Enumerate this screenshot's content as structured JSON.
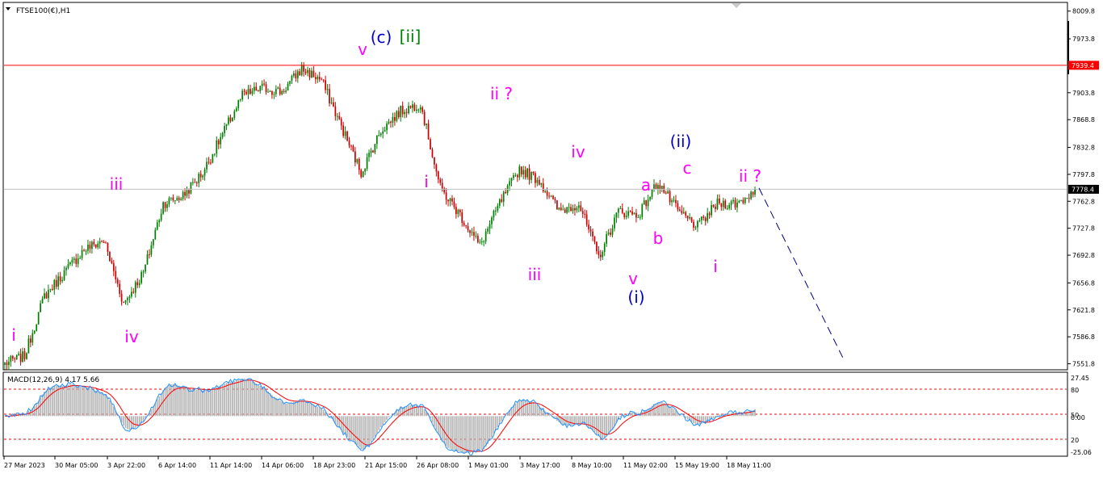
{
  "window": {
    "symbol_label": "FTSE100(€),H1"
  },
  "price_axis": {
    "ticks": [
      "8009.8",
      "7973.8",
      "7939.4",
      "7903.8",
      "7868.8",
      "7832.8",
      "7797.8",
      "7762.8",
      "7727.8",
      "7692.8",
      "7656.8",
      "7621.8",
      "7586.8",
      "7551.8"
    ],
    "hline_red_label": "7939.4",
    "current_price_label": "7778.4"
  },
  "macd": {
    "label": "MACD(12,26,9) 4.17 5.66",
    "ticks": [
      "27.45",
      "80",
      "50",
      "0.00",
      "20",
      "-25.06"
    ]
  },
  "time_axis": {
    "labels": [
      "27 Mar 2023",
      "30 Mar 05:00",
      "3 Apr 22:00",
      "6 Apr 14:00",
      "11 Apr 14:00",
      "14 Apr 06:00",
      "18 Apr 23:00",
      "21 Apr 15:00",
      "26 Apr 08:00",
      "1 May 01:00",
      "3 May 17:00",
      "8 May 10:00",
      "11 May 02:00",
      "15 May 19:00",
      "18 May 11:00"
    ]
  },
  "annotations": [
    {
      "text": "i",
      "color": "#ff00ff"
    },
    {
      "text": "iii",
      "color": "#ff00ff"
    },
    {
      "text": "iv",
      "color": "#ff00ff"
    },
    {
      "text": "v",
      "color": "#ff00ff"
    },
    {
      "text": "(c)",
      "color": "#0000cc"
    },
    {
      "text": "[ii]",
      "color": "#008000"
    },
    {
      "text": "i",
      "color": "#ff00ff"
    },
    {
      "text": "ii ?",
      "color": "#ff00ff"
    },
    {
      "text": "iii",
      "color": "#ff00ff"
    },
    {
      "text": "iv",
      "color": "#ff00ff"
    },
    {
      "text": "v",
      "color": "#ff00ff"
    },
    {
      "text": "(i)",
      "color": "#0000cc"
    },
    {
      "text": "a",
      "color": "#ff00ff"
    },
    {
      "text": "b",
      "color": "#ff00ff"
    },
    {
      "text": "c",
      "color": "#ff00ff"
    },
    {
      "text": "(ii)",
      "color": "#0000cc"
    },
    {
      "text": "i",
      "color": "#ff00ff"
    },
    {
      "text": "ii ?",
      "color": "#ff00ff"
    }
  ],
  "colors": {
    "bull_candle": "#008000",
    "bear_candle": "#cc0000",
    "resistance_line": "#ff0000",
    "price_line": "#c0c0c0",
    "projection": "#000080",
    "macd_hist": "#b4b4b4",
    "macd_signal": "#ff0000",
    "macd_line": "#1e90ff"
  },
  "chart_data": {
    "type": "candlestick",
    "title": "FTSE100(€),H1",
    "timeframe": "H1",
    "ylim": [
      7545,
      8020
    ],
    "resistance_level": 7939.4,
    "last_price": 7778.4,
    "price_path": [
      {
        "t": "27 Mar 2023",
        "price": 7552
      },
      {
        "t": "28 Mar",
        "price": 7562
      },
      {
        "t": "30 Mar 05:00",
        "price": 7640
      },
      {
        "t": "31 Mar",
        "price": 7670
      },
      {
        "t": "2 Apr",
        "price": 7700
      },
      {
        "t": "3 Apr 18:00",
        "price": 7712
      },
      {
        "t": "3 Apr 22:00",
        "price": 7630
      },
      {
        "t": "5 Apr",
        "price": 7670
      },
      {
        "t": "6 Apr 14:00",
        "price": 7760
      },
      {
        "t": "10 Apr",
        "price": 7770
      },
      {
        "t": "11 Apr 14:00",
        "price": 7800
      },
      {
        "t": "13 Apr",
        "price": 7850
      },
      {
        "t": "14 Apr 06:00",
        "price": 7900
      },
      {
        "t": "17 Apr",
        "price": 7910
      },
      {
        "t": "18 Apr 23:00",
        "price": 7905
      },
      {
        "t": "21 Apr 07:00",
        "price": 7935
      },
      {
        "t": "21 Apr 15:00",
        "price": 7920
      },
      {
        "t": "25 Apr",
        "price": 7860
      },
      {
        "t": "26 Apr 08:00",
        "price": 7800
      },
      {
        "t": "27 Apr",
        "price": 7855
      },
      {
        "t": "28 Apr",
        "price": 7880
      },
      {
        "t": "1 May 01:00",
        "price": 7890
      },
      {
        "t": "2 May",
        "price": 7780
      },
      {
        "t": "3 May 05:00",
        "price": 7745
      },
      {
        "t": "3 May 17:00",
        "price": 7705
      },
      {
        "t": "4 May",
        "price": 7760
      },
      {
        "t": "8 May 10:00",
        "price": 7805
      },
      {
        "t": "9 May",
        "price": 7790
      },
      {
        "t": "10 May",
        "price": 7750
      },
      {
        "t": "11 May 02:00",
        "price": 7760
      },
      {
        "t": "11 May 18:00",
        "price": 7690
      },
      {
        "t": "12 May",
        "price": 7750
      },
      {
        "t": "13 May",
        "price": 7745
      },
      {
        "t": "15 May 08:00",
        "price": 7788
      },
      {
        "t": "15 May 19:00",
        "price": 7750
      },
      {
        "t": "16 May",
        "price": 7730
      },
      {
        "t": "17 May",
        "price": 7760
      },
      {
        "t": "18 May 11:00",
        "price": 7760
      },
      {
        "t": "19 May",
        "price": 7778
      }
    ],
    "projection": {
      "from": 7780,
      "to": 7555,
      "style": "dashed"
    },
    "macd": {
      "fast": 12,
      "slow": 26,
      "signal": 9,
      "main": 4.17,
      "signal_value": 5.66,
      "ylim": [
        -25.06,
        27.45
      ],
      "levels": [
        80,
        50,
        20
      ]
    }
  }
}
